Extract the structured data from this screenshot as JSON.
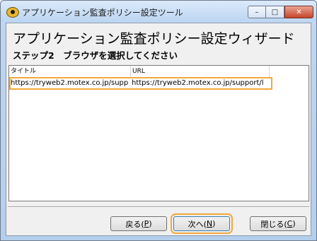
{
  "window": {
    "title": "アプリケーション監査ポリシー設定ツール",
    "controls": {
      "minimize": "–",
      "maximize": "□",
      "close": "✕"
    }
  },
  "wizard": {
    "title": "アプリケーション監査ポリシー設定ウィザード",
    "step": "ステップ2　ブラウザを選択してください"
  },
  "list": {
    "columns": [
      "タイトル",
      "URL"
    ],
    "rows": [
      {
        "title": "https://tryweb2.motex.co.jp/supp",
        "url": "https://tryweb2.motex.co.jp/support/l"
      }
    ]
  },
  "buttons": {
    "back": {
      "label": "戻る(",
      "key": "P",
      "tail": ")"
    },
    "next": {
      "label": "次へ(",
      "key": "N",
      "tail": ")"
    },
    "close": {
      "label": "閉じる(",
      "key": "C",
      "tail": ")"
    }
  },
  "colors": {
    "highlight": "#f2a93a",
    "title_bar": "#bcd5f1"
  }
}
